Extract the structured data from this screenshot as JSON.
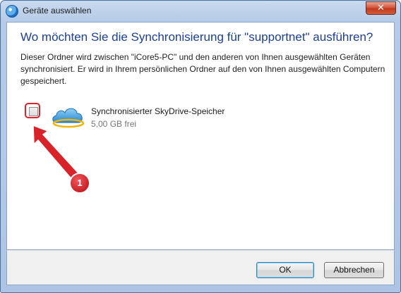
{
  "window": {
    "title": "Geräte auswählen",
    "close_glyph": "✕"
  },
  "main": {
    "heading": "Wo möchten Sie die Synchronisierung für \"supportnet\" ausführen?",
    "description": "Dieser Ordner wird zwischen \"iCore5-PC\" und den anderen von Ihnen ausgewählten Geräten synchronisiert. Er wird in Ihrem persönlichen Ordner auf den von Ihnen ausgewählten Computern gespeichert.",
    "devices": [
      {
        "name": "Synchronisierter SkyDrive-Speicher",
        "free": "5,00 GB frei",
        "checked": false,
        "icon": "skydrive-cloud-icon"
      }
    ]
  },
  "annotation": {
    "number": "1",
    "color": "#d8232a"
  },
  "footer": {
    "ok_label": "OK",
    "cancel_label": "Abbrechen"
  },
  "colors": {
    "heading": "#1c3f94",
    "highlight": "#e0202a"
  }
}
